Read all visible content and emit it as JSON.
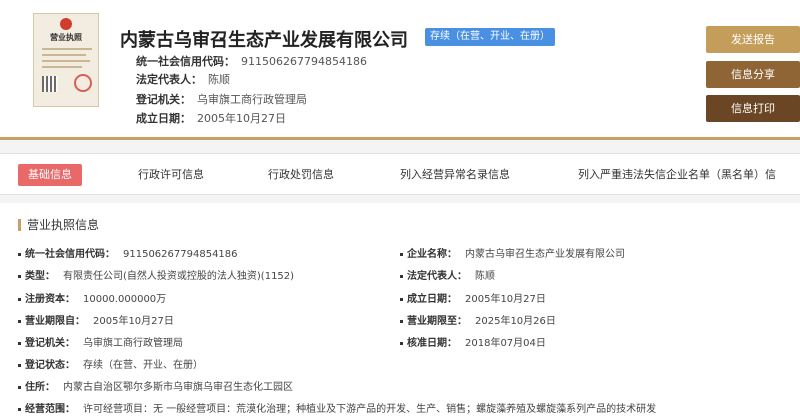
{
  "header": {
    "license_title": "营业执照",
    "company_name": "内蒙古乌审召生态产业发展有限公司",
    "status": "存续（在营、开业、在册）",
    "credit_code_label": "统一社会信用代码：",
    "credit_code": "911506267794854186",
    "legal_rep_label": "法定代表人：",
    "legal_rep": "陈顺",
    "registry_label": "登记机关：",
    "registry": "乌审旗工商行政管理局",
    "founded_label": "成立日期：",
    "founded": "2005年10月27日"
  },
  "actions": {
    "report": "发送报告",
    "share": "信息分享",
    "print": "信息打印"
  },
  "tabs": [
    "基础信息",
    "行政许可信息",
    "行政处罚信息",
    "列入经营异常名录信息",
    "列入严重违法失信企业名单（黑名单）信"
  ],
  "info": {
    "section_title": "营业执照信息",
    "rows": [
      {
        "k": "统一社会信用代码：",
        "v": "911506267794854186"
      },
      {
        "k": "企业名称：",
        "v": "内蒙古乌审召生态产业发展有限公司"
      },
      {
        "k": "类型：",
        "v": "有限责任公司(自然人投资或控股的法人独资)(1152)"
      },
      {
        "k": "法定代表人：",
        "v": "陈顺"
      },
      {
        "k": "注册资本：",
        "v": "10000.000000万"
      },
      {
        "k": "成立日期：",
        "v": "2005年10月27日"
      },
      {
        "k": "营业期限自：",
        "v": "2005年10月27日"
      },
      {
        "k": "营业期限至：",
        "v": "2025年10月26日"
      },
      {
        "k": "登记机关：",
        "v": "乌审旗工商行政管理局"
      },
      {
        "k": "核准日期：",
        "v": "2018年07月04日"
      },
      {
        "k": "登记状态：",
        "v": "存续（在营、开业、在册）"
      },
      {
        "k": "住所：",
        "v": "内蒙古自治区鄂尔多斯市乌审旗乌审召生态化工园区"
      },
      {
        "k": "经营范围：",
        "v": "许可经营项目：无 一般经营项目：荒漠化治理；种植业及下游产品的开发、生产、销售；螺旋藻养殖及螺旋藻系列产品的技术研发"
      }
    ]
  }
}
